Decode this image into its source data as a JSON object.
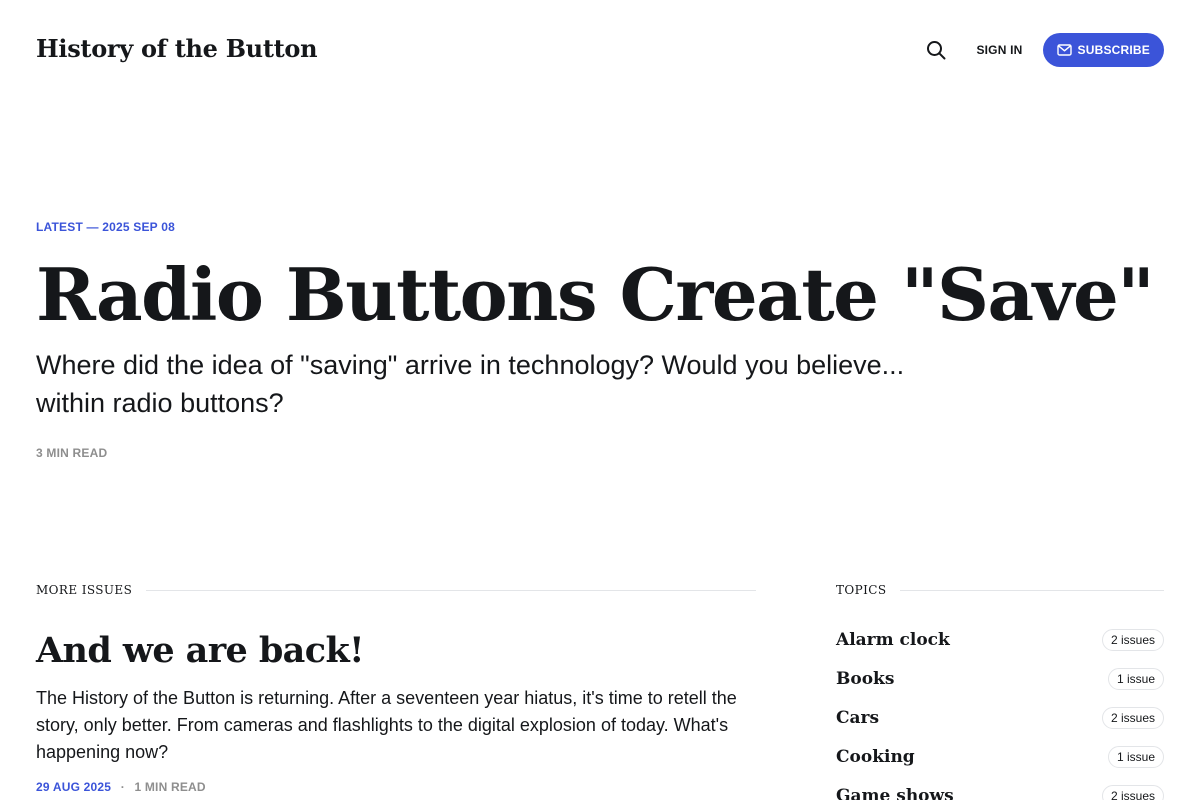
{
  "header": {
    "site_title": "History of the Button",
    "sign_in_label": "SIGN IN",
    "subscribe_label": "SUBSCRIBE",
    "search_icon": "search-icon",
    "subscribe_icon": "mail-icon"
  },
  "hero": {
    "meta": "LATEST — 2025 SEP 08",
    "title": "Radio Buttons Create \"Save\"",
    "excerpt": "Where did the idea of \"saving\" arrive in technology? Would you believe... within radio buttons?",
    "read_time": "3 MIN READ"
  },
  "more_issues": {
    "heading": "MORE ISSUES",
    "posts": [
      {
        "title": "And we are back!",
        "excerpt": "The History of the Button is returning. After a seventeen year hiatus, it's time to retell the story, only better. From cameras and flashlights to the digital explosion of today. What's happening now?",
        "date": "29 AUG 2025",
        "separator": "·",
        "read_time": "1 MIN READ"
      }
    ]
  },
  "topics": {
    "heading": "TOPICS",
    "items": [
      {
        "name": "Alarm clock",
        "count": "2 issues"
      },
      {
        "name": "Books",
        "count": "1 issue"
      },
      {
        "name": "Cars",
        "count": "2 issues"
      },
      {
        "name": "Cooking",
        "count": "1 issue"
      },
      {
        "name": "Game shows",
        "count": "2 issues"
      }
    ]
  },
  "colors": {
    "accent": "#3b54d9",
    "text": "#15171a",
    "muted": "#8e8e8e",
    "rule": "#e3e5e8"
  }
}
